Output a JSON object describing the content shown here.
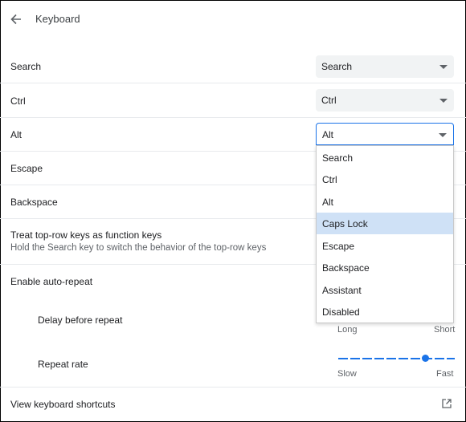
{
  "header": {
    "title": "Keyboard"
  },
  "settings": {
    "search": {
      "label": "Search",
      "value": "Search"
    },
    "ctrl": {
      "label": "Ctrl",
      "value": "Ctrl"
    },
    "alt": {
      "label": "Alt",
      "value": "Alt"
    },
    "escape": {
      "label": "Escape"
    },
    "backspace": {
      "label": "Backspace"
    },
    "toprow": {
      "label": "Treat top-row keys as function keys",
      "sub": "Hold the Search key to switch the behavior of the top-row keys"
    },
    "autorepeat": {
      "label": "Enable auto-repeat"
    },
    "delay": {
      "label": "Delay before repeat",
      "min": "Long",
      "max": "Short"
    },
    "rate": {
      "label": "Repeat rate",
      "min": "Slow",
      "max": "Fast",
      "level": 0.75
    },
    "shortcuts": {
      "label": "View keyboard shortcuts"
    }
  },
  "dropdown": {
    "options": [
      "Search",
      "Ctrl",
      "Alt",
      "Caps Lock",
      "Escape",
      "Backspace",
      "Assistant",
      "Disabled"
    ],
    "highlighted": "Caps Lock"
  },
  "colors": {
    "accent": "#1a73e8",
    "highlight": "#cfe1f6"
  }
}
